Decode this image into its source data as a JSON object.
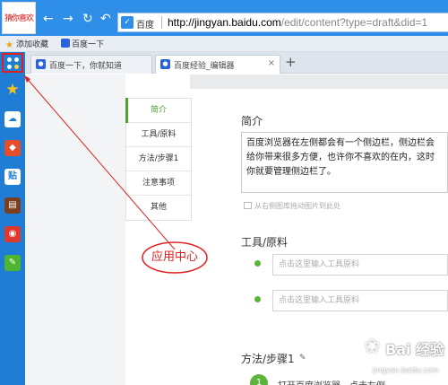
{
  "toolbar": {
    "logo_text": "猜你喜欢",
    "back_icon": "←",
    "forward_icon": "→",
    "refresh_icon": "↻",
    "undo_icon": "↶",
    "site_label": "百度",
    "url_host": "http://jingyan.baidu.com",
    "url_path": "/edit/content?type=draft&did=1"
  },
  "bookmarks": [
    {
      "label": "添加收藏"
    },
    {
      "label": "百度一下"
    }
  ],
  "tabs": [
    {
      "label": "百度一下，你就知道"
    },
    {
      "label": "百度经验_编辑器"
    }
  ],
  "newtab_icon": "+",
  "nav": [
    {
      "label": "简介"
    },
    {
      "label": "工具/原料"
    },
    {
      "label": "方法/步骤1"
    },
    {
      "label": "注意事项"
    },
    {
      "label": "其他"
    }
  ],
  "intro": {
    "title": "简介",
    "text": "百度浏览器在左侧都会有一个侧边栏，侧边栏会给你带来很多方便，也许你不喜欢的在内，这时你就要管理侧边栏了。",
    "hint": "从右侧图库拖动图片到此处"
  },
  "tools": {
    "title": "工具/原料",
    "placeholder": "点击这里输入工具原料"
  },
  "steps": {
    "title": "方法/步骤1",
    "pencil_icon": "✎",
    "number": "1",
    "text": "打开百度浏览器，点击左侧..."
  },
  "annotation": {
    "label": "应用中心",
    "color": "#e02020"
  },
  "watermark": {
    "brand": "Bai 经验",
    "url": "jingyan.baidu.com"
  },
  "colors": {
    "toolbar": "#2f8ee8",
    "sidebar": "#1f7dd6",
    "accent_green": "#5cb43b"
  }
}
